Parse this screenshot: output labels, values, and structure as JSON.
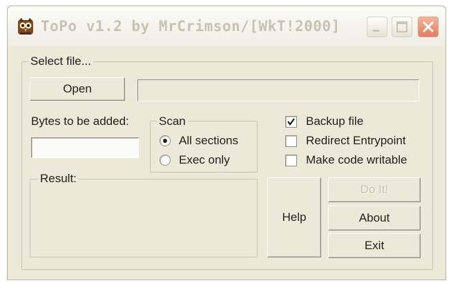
{
  "window": {
    "title": "ToPo v1.2 by MrCrimson/[WkT!2000]",
    "icon": "owl-app-icon",
    "controls": {
      "minimize": "minimize-icon",
      "maximize": "maximize-icon",
      "close": "close-icon"
    }
  },
  "select_file": {
    "legend": "Select file...",
    "open_label": "Open",
    "path_value": ""
  },
  "bytes": {
    "label": "Bytes to be added:",
    "value": ""
  },
  "scan": {
    "legend": "Scan",
    "options": [
      {
        "label": "All sections",
        "selected": true
      },
      {
        "label": "Exec only",
        "selected": false
      }
    ]
  },
  "options": [
    {
      "label": "Backup file",
      "checked": true
    },
    {
      "label": "Redirect Entrypoint",
      "checked": false
    },
    {
      "label": "Make code writable",
      "checked": false
    }
  ],
  "result": {
    "legend": "Result:"
  },
  "buttons": {
    "help": "Help",
    "doit": "Do It!",
    "about": "About",
    "exit": "Exit"
  },
  "colors": {
    "face": "#ece9d8",
    "title_text": "#c7c3b3",
    "close": "#e27e60"
  }
}
